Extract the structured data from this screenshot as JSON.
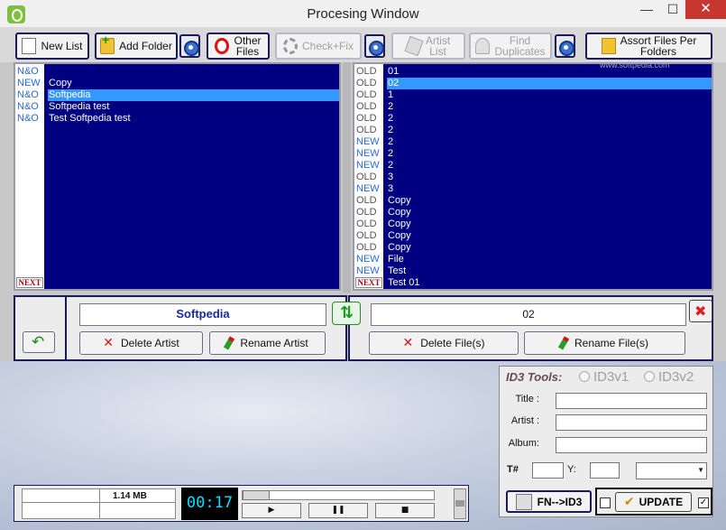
{
  "window": {
    "title": "Procesing Window",
    "min": "—",
    "max": "☐",
    "close": "✕"
  },
  "toolbar": {
    "new_list": "New List",
    "add_folder": "Add Folder",
    "other_files": "Other\nFiles",
    "check_fix": "Check+Fix",
    "artist_list": "Artist\nList",
    "find_duplicates": "Find\nDuplicates",
    "assort": "Assort Files Per\nFolders"
  },
  "watermark": "www.softpedia.com",
  "left_list": {
    "rows": [
      {
        "tag": "N&O",
        "name": "",
        "tagtype": "nando",
        "selected": false
      },
      {
        "tag": "NEW",
        "name": "Copy",
        "tagtype": "new",
        "selected": false
      },
      {
        "tag": "N&O",
        "name": "Softpedia",
        "tagtype": "nando",
        "selected": true
      },
      {
        "tag": "N&O",
        "name": "Softpedia test",
        "tagtype": "nando",
        "selected": false
      },
      {
        "tag": "N&O",
        "name": "Test Softpedia test",
        "tagtype": "nando",
        "selected": false
      }
    ],
    "next_label": "NEXT"
  },
  "right_list": {
    "rows": [
      {
        "tag": "OLD",
        "name": "01",
        "tagtype": "old",
        "selected": false
      },
      {
        "tag": "OLD",
        "name": "02",
        "tagtype": "old",
        "selected": true
      },
      {
        "tag": "OLD",
        "name": "1",
        "tagtype": "old",
        "selected": false
      },
      {
        "tag": "OLD",
        "name": "2",
        "tagtype": "old",
        "selected": false
      },
      {
        "tag": "OLD",
        "name": "2",
        "tagtype": "old",
        "selected": false
      },
      {
        "tag": "OLD",
        "name": "2",
        "tagtype": "old",
        "selected": false
      },
      {
        "tag": "NEW",
        "name": "2",
        "tagtype": "new",
        "selected": false
      },
      {
        "tag": "NEW",
        "name": "2",
        "tagtype": "new",
        "selected": false
      },
      {
        "tag": "NEW",
        "name": "2",
        "tagtype": "new",
        "selected": false
      },
      {
        "tag": "OLD",
        "name": "3",
        "tagtype": "old",
        "selected": false
      },
      {
        "tag": "NEW",
        "name": "3",
        "tagtype": "new",
        "selected": false
      },
      {
        "tag": "OLD",
        "name": "Copy",
        "tagtype": "old",
        "selected": false
      },
      {
        "tag": "OLD",
        "name": "Copy",
        "tagtype": "old",
        "selected": false
      },
      {
        "tag": "OLD",
        "name": "Copy",
        "tagtype": "old",
        "selected": false
      },
      {
        "tag": "OLD",
        "name": "Copy",
        "tagtype": "old",
        "selected": false
      },
      {
        "tag": "OLD",
        "name": "Copy",
        "tagtype": "old",
        "selected": false
      },
      {
        "tag": "NEW",
        "name": "File",
        "tagtype": "new",
        "selected": false
      },
      {
        "tag": "NEW",
        "name": "Test",
        "tagtype": "new",
        "selected": false
      },
      {
        "tag": "",
        "name": "Test 01",
        "tagtype": "old",
        "selected": false
      }
    ],
    "next_label": "NEXT"
  },
  "artist_ctrl": {
    "field_value": "Softpedia",
    "delete_label": "Delete Artist",
    "rename_label": "Rename Artist"
  },
  "file_ctrl": {
    "field_value": "02",
    "delete_label": "Delete File(s)",
    "rename_label": "Rename File(s)"
  },
  "id3": {
    "title": "ID3 Tools:",
    "v1": "ID3v1",
    "v2": "ID3v2",
    "title_label": "Title :",
    "artist_label": "Artist :",
    "album_label": "Album:",
    "track_label": "T#",
    "year_label": "Y:",
    "fn_button": "FN-->ID3",
    "update_button": "UPDATE",
    "update_checked": "✓"
  },
  "player": {
    "size": "1.14 MB",
    "time": "00:17",
    "play": "▶",
    "pause": "❚❚",
    "stop": "■"
  },
  "colors": {
    "list_bg": "#000080",
    "selection": "#3399ff",
    "close_red": "#c7372f"
  }
}
